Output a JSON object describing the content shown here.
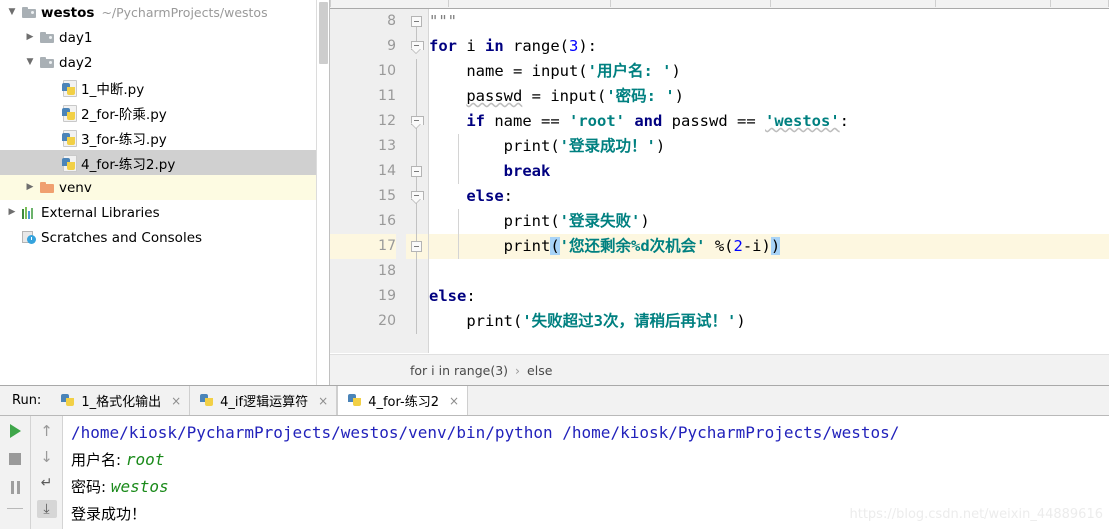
{
  "project_tree": {
    "items": [
      {
        "label": "westos",
        "path": "~/PycharmProjects/westos",
        "icon": "folder-icon",
        "indent": 0,
        "arrow": "down",
        "bold": true,
        "state": "normal"
      },
      {
        "label": "day1",
        "path": "",
        "icon": "folder-icon",
        "indent": 1,
        "arrow": "right",
        "bold": false,
        "state": "normal"
      },
      {
        "label": "day2",
        "path": "",
        "icon": "folder-icon",
        "indent": 1,
        "arrow": "down",
        "bold": false,
        "state": "normal"
      },
      {
        "label": "1_中断.py",
        "path": "",
        "icon": "python-file-icon",
        "indent": 2,
        "arrow": "none",
        "bold": false,
        "state": "normal"
      },
      {
        "label": "2_for-阶乘.py",
        "path": "",
        "icon": "python-file-icon",
        "indent": 2,
        "arrow": "none",
        "bold": false,
        "state": "normal"
      },
      {
        "label": "3_for-练习.py",
        "path": "",
        "icon": "python-file-icon",
        "indent": 2,
        "arrow": "none",
        "bold": false,
        "state": "normal"
      },
      {
        "label": "4_for-练习2.py",
        "path": "",
        "icon": "python-file-icon",
        "indent": 2,
        "arrow": "none",
        "bold": false,
        "state": "selected"
      },
      {
        "label": "venv",
        "path": "",
        "icon": "folder-orange-icon",
        "indent": 1,
        "arrow": "right",
        "bold": false,
        "state": "venv"
      },
      {
        "label": "External Libraries",
        "path": "",
        "icon": "libraries-icon",
        "indent": 0,
        "arrow": "right",
        "bold": false,
        "state": "normal"
      },
      {
        "label": "Scratches and Consoles",
        "path": "",
        "icon": "scratches-icon",
        "indent": 0,
        "arrow": "none",
        "bold": false,
        "state": "normal"
      }
    ]
  },
  "editor": {
    "lines": [
      {
        "num": "8",
        "fold": "square",
        "highlight": false
      },
      {
        "num": "9",
        "fold": "chevron",
        "highlight": false
      },
      {
        "num": "10",
        "fold": "none",
        "highlight": false
      },
      {
        "num": "11",
        "fold": "none",
        "highlight": false
      },
      {
        "num": "12",
        "fold": "chevron",
        "highlight": false
      },
      {
        "num": "13",
        "fold": "none",
        "highlight": false
      },
      {
        "num": "14",
        "fold": "square",
        "highlight": false
      },
      {
        "num": "15",
        "fold": "chevron",
        "highlight": false
      },
      {
        "num": "16",
        "fold": "none",
        "highlight": false
      },
      {
        "num": "17",
        "fold": "square",
        "highlight": true
      },
      {
        "num": "18",
        "fold": "none",
        "highlight": false
      },
      {
        "num": "19",
        "fold": "none",
        "highlight": false
      },
      {
        "num": "20",
        "fold": "none",
        "highlight": false
      }
    ],
    "source": [
      "\"\"\"",
      "for i in range(3):",
      "    name = input('用户名: ')",
      "    passwd = input('密码: ')",
      "    if name == 'root' and passwd == 'westos':",
      "        print('登录成功！')",
      "        break",
      "    else:",
      "        print('登录失败')",
      "        print('您还剩余%d次机会' %(2-i))",
      "",
      "else:",
      "    print('失败超过3次，请稍后再试！')"
    ],
    "breadcrumb": {
      "first": "for i in range(3)",
      "separator": "›",
      "second": "else"
    },
    "colors": {
      "keyword": "#000080",
      "string": "#008080",
      "number": "#0000ff",
      "highlight_line": "#fdf7e0",
      "paren_match": "#a8d3f7"
    }
  },
  "run_panel": {
    "label": "Run:",
    "tabs": [
      {
        "label": "1_格式化输出",
        "active": false,
        "close": "×",
        "icon": "python-icon"
      },
      {
        "label": "4_if逻辑运算符",
        "active": false,
        "close": "×",
        "icon": "python-icon"
      },
      {
        "label": "4_for-练习2",
        "active": true,
        "close": "×",
        "icon": "python-icon"
      }
    ],
    "toolbar_left": [
      {
        "name": "rerun-button",
        "icon": "play-icon"
      },
      {
        "name": "stop-button",
        "icon": "stop-icon"
      },
      {
        "name": "pause-button",
        "icon": "pause-icon"
      }
    ],
    "toolbar_right": [
      {
        "name": "up-stack-button",
        "icon": "arrow-up-icon",
        "glyph": "↑"
      },
      {
        "name": "down-stack-button",
        "icon": "arrow-down-icon",
        "glyph": "↓"
      },
      {
        "name": "soft-wrap-button",
        "icon": "wrap-text-icon",
        "glyph": "↵"
      },
      {
        "name": "scroll-to-end-button",
        "icon": "scroll-end-icon",
        "glyph": "⤓"
      }
    ],
    "console": {
      "command": "/home/kiosk/PycharmProjects/westos/venv/bin/python /home/kiosk/PycharmProjects/westos/",
      "lines": [
        {
          "type": "prompt",
          "prompt": "用户名: ",
          "value": "root"
        },
        {
          "type": "prompt",
          "prompt": "密码: ",
          "value": "westos"
        },
        {
          "type": "output",
          "text": "登录成功！"
        }
      ]
    }
  },
  "watermark": "https://blog.csdn.net/weixin_44889616"
}
